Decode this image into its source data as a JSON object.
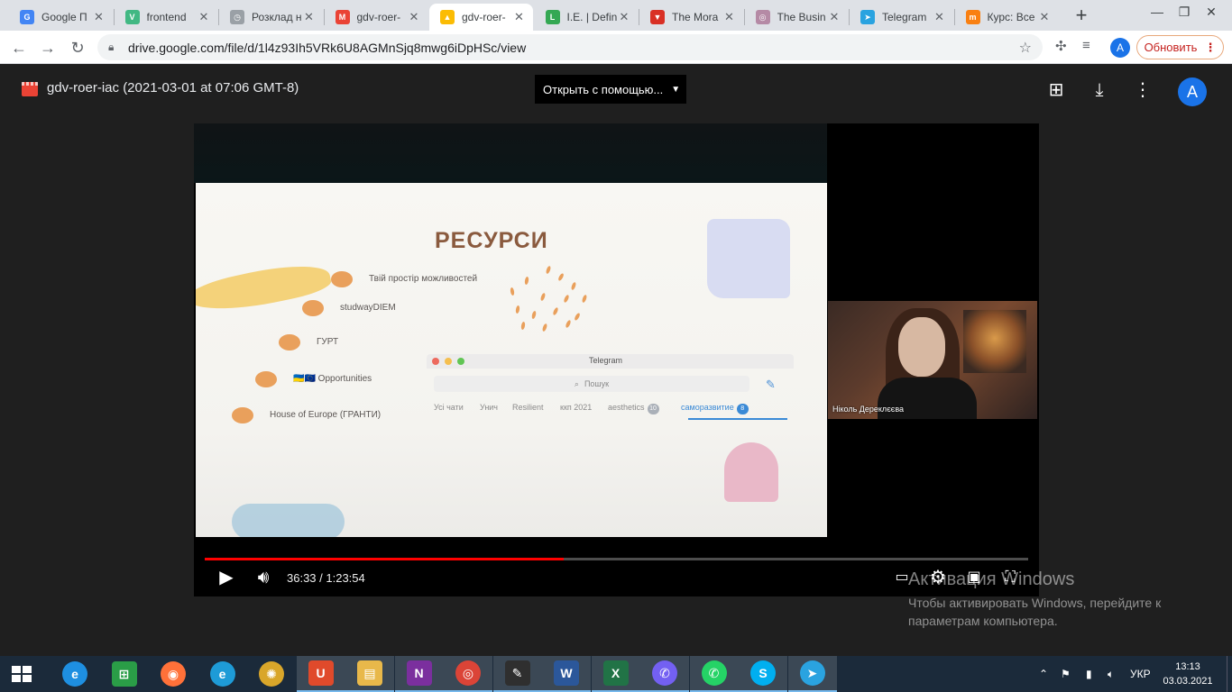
{
  "browser": {
    "tabs": [
      {
        "title": "Google П",
        "favicon": "google-translate",
        "color": "#4285f4",
        "glyph": "G"
      },
      {
        "title": "frontend",
        "favicon": "vuejs",
        "color": "#41b883",
        "glyph": "V"
      },
      {
        "title": "Розклад н",
        "favicon": "clock",
        "color": "#9aa0a6",
        "glyph": "◷"
      },
      {
        "title": "gdv-roer-",
        "favicon": "gmail",
        "color": "#ea4335",
        "glyph": "M"
      },
      {
        "title": "gdv-roer-",
        "favicon": "google-drive",
        "color": "#fbbc04",
        "glyph": "▲"
      },
      {
        "title": "I.E. | Defin",
        "favicon": "letter-l",
        "color": "#34a853",
        "glyph": "L"
      },
      {
        "title": "The Mora",
        "favicon": "bookmark-red",
        "color": "#d93025",
        "glyph": "▼"
      },
      {
        "title": "The Busin",
        "favicon": "business",
        "color": "#b58aa5",
        "glyph": "◎"
      },
      {
        "title": "Telegram",
        "favicon": "telegram",
        "color": "#2aa3e0",
        "glyph": "➤"
      },
      {
        "title": "Курс: Все",
        "favicon": "moodle",
        "color": "#f98012",
        "glyph": "m"
      }
    ],
    "active_tab_index": 4,
    "new_tab": "+",
    "window_controls": {
      "minimize": "—",
      "restore": "❐",
      "close": "✕"
    },
    "url": "drive.google.com/file/d/1l4z93Ih5VRk6U8AGMnSjq8mwg6iDpHSc/view",
    "profile_initial": "A",
    "update_label": "Обновить"
  },
  "viewer": {
    "file_title": "gdv-roer-iac (2021-03-01 at 07:06 GMT-8)",
    "open_with_label": "Открыть с помощью...",
    "profile_initial": "A"
  },
  "slide": {
    "title": "РЕСУРСИ",
    "resources": [
      "Твій простір можливостей",
      "studwayDIEM",
      "ГУРТ",
      "🇺🇦🇪🇺 Opportunities",
      "House of Europe (ГРАНТИ)"
    ],
    "telegram": {
      "window_title": "Telegram",
      "search_placeholder": "Пошук",
      "tabs": [
        {
          "label": "Усі чати",
          "badge": ""
        },
        {
          "label": "Унич",
          "badge": ""
        },
        {
          "label": "Resilient",
          "badge": ""
        },
        {
          "label": "ккп 2021",
          "badge": ""
        },
        {
          "label": "aesthetics",
          "badge": "10"
        },
        {
          "label": "саморазвитие",
          "badge": "8"
        }
      ],
      "active_tab": 5
    }
  },
  "participant": {
    "name": "Ніколь Дереклєєва"
  },
  "player": {
    "current_time": "36:33",
    "duration": "1:23:54",
    "time_display": "36:33 / 1:23:54",
    "progress_fraction": 0.436
  },
  "watermark": {
    "line1": "Активация Windows",
    "line2": "Чтобы активировать Windows, перейдите к",
    "line3": "параметрам компьютера."
  },
  "taskbar": {
    "apps": [
      {
        "name": "internet-explorer",
        "color": "#1e8fe1",
        "glyph": "e",
        "running": false,
        "round": true
      },
      {
        "name": "microsoft-store",
        "color": "#2a9d47",
        "glyph": "⊞",
        "running": false,
        "round": false
      },
      {
        "name": "firefox",
        "color": "#ff7139",
        "glyph": "◉",
        "running": false,
        "round": true
      },
      {
        "name": "edge",
        "color": "#1e9bd7",
        "glyph": "e",
        "running": false,
        "round": true
      },
      {
        "name": "media-center",
        "color": "#d9a62a",
        "glyph": "✺",
        "running": false,
        "round": true
      },
      {
        "name": "file-app",
        "color": "#e04a2b",
        "glyph": "U",
        "running": true,
        "round": false
      },
      {
        "name": "file-explorer",
        "color": "#e8b84a",
        "glyph": "▤",
        "running": true,
        "round": false
      },
      {
        "name": "onenote",
        "color": "#7b2f9e",
        "glyph": "N",
        "running": true,
        "round": false
      },
      {
        "name": "chrome",
        "color": "#db4437",
        "glyph": "◎",
        "running": true,
        "round": true
      },
      {
        "name": "reader",
        "color": "#2f2f2f",
        "glyph": "✎",
        "running": true,
        "round": false
      },
      {
        "name": "word",
        "color": "#2b579a",
        "glyph": "W",
        "running": true,
        "round": false
      },
      {
        "name": "excel",
        "color": "#217346",
        "glyph": "X",
        "running": true,
        "round": false
      },
      {
        "name": "viber",
        "color": "#7360f2",
        "glyph": "✆",
        "running": true,
        "round": true
      },
      {
        "name": "whatsapp",
        "color": "#25d366",
        "glyph": "✆",
        "running": true,
        "round": true
      },
      {
        "name": "skype",
        "color": "#00aff0",
        "glyph": "S",
        "running": true,
        "round": true
      },
      {
        "name": "telegram",
        "color": "#2aa3e0",
        "glyph": "➤",
        "running": true,
        "round": true
      }
    ],
    "language": "УКР",
    "time": "13:13",
    "date": "03.03.2021"
  },
  "colors": {
    "accent": "#1a73e8",
    "progress": "#ff0000",
    "viewer_bg": "#1f1f1f"
  }
}
